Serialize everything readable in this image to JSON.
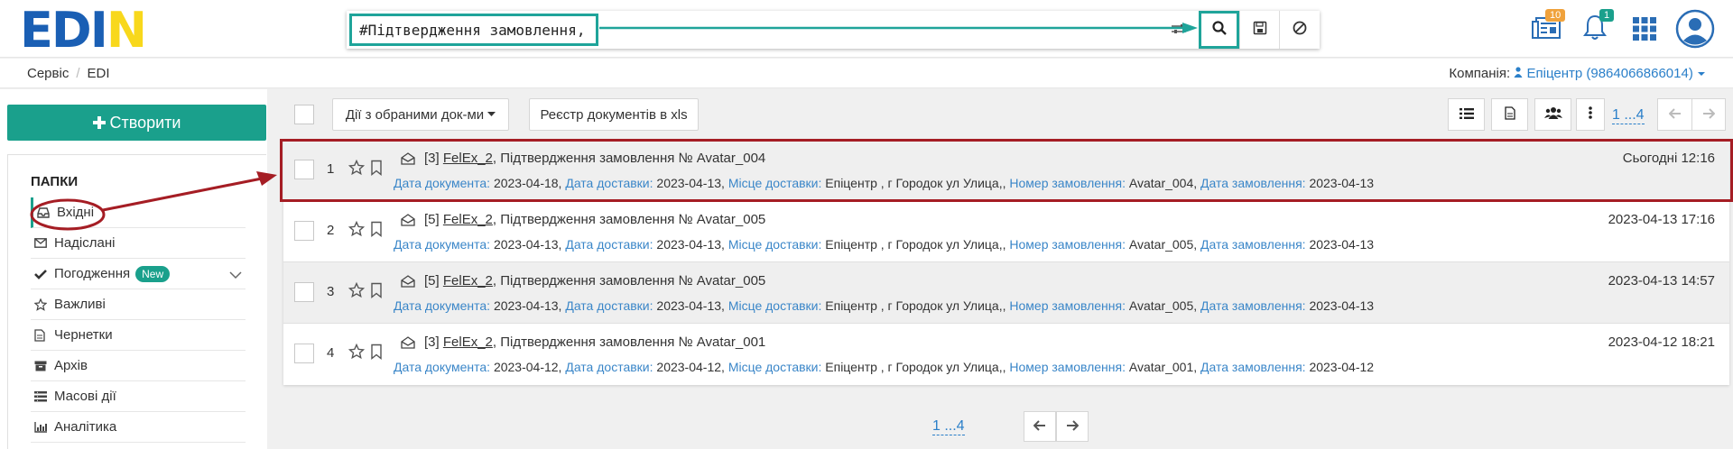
{
  "brand": {
    "logo_ed": "ED",
    "logo_i": "I",
    "logo_n": "N"
  },
  "search": {
    "value": "#Підтвердження замовлення,",
    "find_icon": "search-icon",
    "save_icon": "save-icon",
    "cancel_icon": "cancel-icon",
    "advanced_icon": "sliders-icon"
  },
  "top_icons": {
    "news_badge": "10",
    "notifications_badge": "1",
    "news_color": "#f0a23c",
    "notif_color": "#1aa08c"
  },
  "breadcrumb": {
    "items": [
      "Сервіс",
      "EDI"
    ]
  },
  "company": {
    "label": "Компанія:",
    "value": "Епіцентр (9864066866014)"
  },
  "sidebar": {
    "create_label": "Створити",
    "folders_title": "ПАПКИ",
    "items": [
      {
        "label": "Вхідні",
        "icon": "inbox-icon"
      },
      {
        "label": "Надіслані",
        "icon": "envelope-icon"
      },
      {
        "label": "Погодження",
        "icon": "check-icon",
        "badge": "New"
      },
      {
        "label": "Важливі",
        "icon": "star-icon"
      },
      {
        "label": "Чернетки",
        "icon": "file-icon"
      },
      {
        "label": "Архів",
        "icon": "archive-icon"
      },
      {
        "label": "Масові дії",
        "icon": "list-icon"
      },
      {
        "label": "Аналітика",
        "icon": "bar-chart-icon"
      }
    ]
  },
  "toolbar": {
    "bulk_actions_label": "Дії з обраними док-ми",
    "export_label": "Реєстр документів в xls",
    "pager": "1 ...4"
  },
  "labels": {
    "doc_date": "Дата документа:",
    "delivery_date": "Дата доставки:",
    "delivery_place": "Місце доставки:",
    "order_number": "Номер замовлення:",
    "order_date": "Дата замовлення:"
  },
  "documents": [
    {
      "num": "1",
      "count": "[3]",
      "sender": "FelEx_2",
      "title": ", Підтвердження замовлення № Avatar_004",
      "doc_date": "2023-04-18,",
      "delivery_date": "2023-04-13,",
      "place": "Епіцентр , г Городок ул Улица,,",
      "order_no": "Avatar_004,",
      "order_date": "2023-04-13",
      "time": "Сьогодні 12:16"
    },
    {
      "num": "2",
      "count": "[5]",
      "sender": "FelEx_2",
      "title": ", Підтвердження замовлення № Avatar_005",
      "doc_date": "2023-04-13,",
      "delivery_date": "2023-04-13,",
      "place": "Епіцентр , г Городок ул Улица,,",
      "order_no": "Avatar_005,",
      "order_date": "2023-04-13",
      "time": "2023-04-13 17:16"
    },
    {
      "num": "3",
      "count": "[5]",
      "sender": "FelEx_2",
      "title": ", Підтвердження замовлення № Avatar_005",
      "doc_date": "2023-04-13,",
      "delivery_date": "2023-04-13,",
      "place": "Епіцентр , г Городок ул Улица,,",
      "order_no": "Avatar_005,",
      "order_date": "2023-04-13",
      "time": "2023-04-13 14:57"
    },
    {
      "num": "4",
      "count": "[3]",
      "sender": "FelEx_2",
      "title": ", Підтвердження замовлення № Avatar_001",
      "doc_date": "2023-04-12,",
      "delivery_date": "2023-04-12,",
      "place": "Епіцентр , г Городок ул Улица,,",
      "order_no": "Avatar_001,",
      "order_date": "2023-04-12",
      "time": "2023-04-12 18:21"
    }
  ],
  "bottom_pager": "1 ...4",
  "colors": {
    "accent": "#1aa08c",
    "highlight_teal": "#1fa49a",
    "annotation_red": "#a51d24",
    "link": "#2a7fc9"
  }
}
